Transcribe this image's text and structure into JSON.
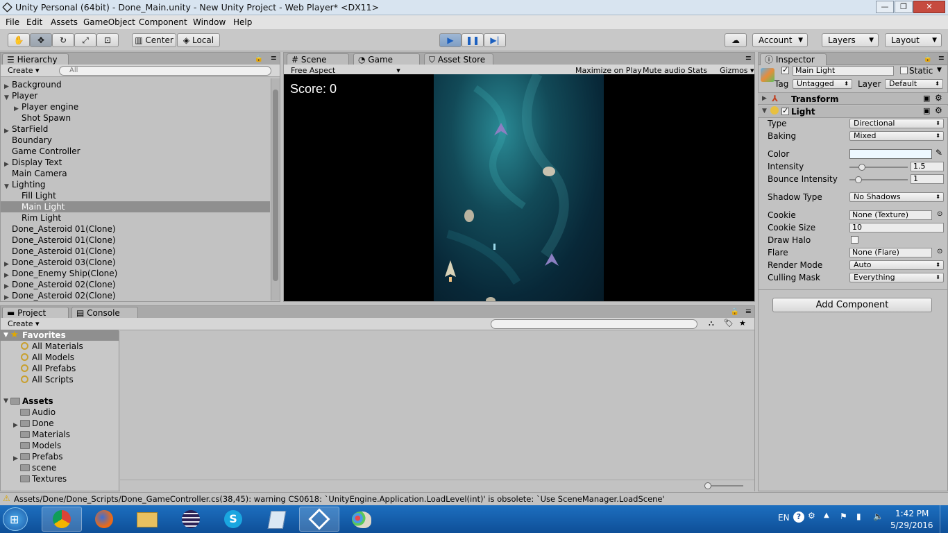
{
  "window": {
    "title": "Unity Personal (64bit) - Done_Main.unity - New Unity Project - Web Player* <DX11>",
    "minimize": "—",
    "maximize": "❐",
    "close": "✕"
  },
  "menu": [
    "File",
    "Edit",
    "Assets",
    "GameObject",
    "Component",
    "Window",
    "Help"
  ],
  "toolbar": {
    "center": "Center",
    "local": "Local",
    "account": "Account",
    "layers": "Layers",
    "layout": "Layout"
  },
  "hierarchy": {
    "tab": "Hierarchy",
    "create": "Create",
    "search_placeholder": "All",
    "items": [
      {
        "label": "Background",
        "indent": 0,
        "expand": "closed"
      },
      {
        "label": "Player",
        "indent": 0,
        "expand": "open"
      },
      {
        "label": "Player engine",
        "indent": 1,
        "expand": "closed"
      },
      {
        "label": "Shot Spawn",
        "indent": 1,
        "expand": "none"
      },
      {
        "label": "StarField",
        "indent": 0,
        "expand": "closed"
      },
      {
        "label": "Boundary",
        "indent": 0,
        "expand": "none"
      },
      {
        "label": "Game Controller",
        "indent": 0,
        "expand": "none"
      },
      {
        "label": "Display Text",
        "indent": 0,
        "expand": "closed"
      },
      {
        "label": "Main Camera",
        "indent": 0,
        "expand": "none"
      },
      {
        "label": "Lighting",
        "indent": 0,
        "expand": "open"
      },
      {
        "label": "Fill Light",
        "indent": 1,
        "expand": "none"
      },
      {
        "label": "Main Light",
        "indent": 1,
        "expand": "none",
        "selected": true
      },
      {
        "label": "Rim Light",
        "indent": 1,
        "expand": "none"
      },
      {
        "label": "Done_Asteroid 01(Clone)",
        "indent": 0,
        "expand": "none"
      },
      {
        "label": "Done_Asteroid 01(Clone)",
        "indent": 0,
        "expand": "none"
      },
      {
        "label": "Done_Asteroid 01(Clone)",
        "indent": 0,
        "expand": "none"
      },
      {
        "label": "Done_Asteroid 03(Clone)",
        "indent": 0,
        "expand": "closed"
      },
      {
        "label": "Done_Enemy Ship(Clone)",
        "indent": 0,
        "expand": "closed"
      },
      {
        "label": "Done_Asteroid 02(Clone)",
        "indent": 0,
        "expand": "closed"
      },
      {
        "label": "Done_Asteroid 02(Clone)",
        "indent": 0,
        "expand": "closed"
      }
    ]
  },
  "scene_tabs": {
    "scene": "Scene",
    "game": "Game",
    "asset_store": "Asset Store"
  },
  "game": {
    "aspect": "Free Aspect",
    "maximize": "Maximize on Play",
    "mute": "Mute audio",
    "stats": "Stats",
    "gizmos": "Gizmos",
    "score": "Score: 0"
  },
  "inspector": {
    "tab": "Inspector",
    "object_name": "Main Light",
    "static": "Static",
    "tag_label": "Tag",
    "tag": "Untagged",
    "layer_label": "Layer",
    "layer": "Default",
    "transform": "Transform",
    "light": "Light",
    "color_swatch": "#eef8ff",
    "props": {
      "type_label": "Type",
      "type": "Directional",
      "baking_label": "Baking",
      "baking": "Mixed",
      "color_label": "Color",
      "intensity_label": "Intensity",
      "intensity": "1.5",
      "bounce_label": "Bounce Intensity",
      "bounce": "1",
      "shadow_label": "Shadow Type",
      "shadow": "No Shadows",
      "cookie_label": "Cookie",
      "cookie": "None (Texture)",
      "cookie_size_label": "Cookie Size",
      "cookie_size": "10",
      "halo_label": "Draw Halo",
      "flare_label": "Flare",
      "flare": "None (Flare)",
      "render_label": "Render Mode",
      "render": "Auto",
      "culling_label": "Culling Mask",
      "culling": "Everything"
    },
    "add_component": "Add Component"
  },
  "project": {
    "tab": "Project",
    "console_tab": "Console",
    "create": "Create",
    "favorites": "Favorites",
    "favorite_items": [
      "All Materials",
      "All Models",
      "All Prefabs",
      "All Scripts"
    ],
    "assets": "Assets",
    "asset_folders": [
      {
        "label": "Audio",
        "expand": "none"
      },
      {
        "label": "Done",
        "expand": "closed"
      },
      {
        "label": "Materials",
        "expand": "none"
      },
      {
        "label": "Models",
        "expand": "none"
      },
      {
        "label": "Prefabs",
        "expand": "closed"
      },
      {
        "label": "scene",
        "expand": "none"
      },
      {
        "label": "Textures",
        "expand": "none"
      }
    ]
  },
  "status": "Assets/Done/Done_Scripts/Done_GameController.cs(38,45): warning CS0618: `UnityEngine.Application.LoadLevel(int)' is obsolete: `Use SceneManager.LoadScene'",
  "taskbar": {
    "lang": "EN",
    "time": "1:42 PM",
    "date": "5/29/2016"
  }
}
